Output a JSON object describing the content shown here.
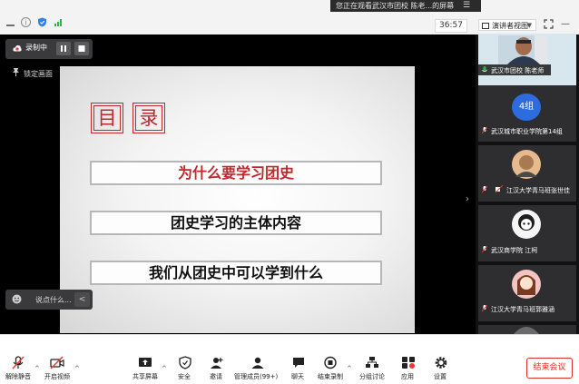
{
  "top_bar": {
    "sharing_banner": "您正在观看武汉市团校 陈老...的屏幕",
    "timer": "36:57",
    "view_mode": "演讲者视图"
  },
  "recording": {
    "label": "录制中"
  },
  "lock_screen": "锁定画面",
  "slide": {
    "toc_chars": [
      "目",
      "录"
    ],
    "items": [
      "为什么要学习团史",
      "团史学习的主体内容",
      "我们从团史中可以学到什么"
    ],
    "highlight_color": "#c0282d"
  },
  "chat": {
    "placeholder": "说点什么..."
  },
  "participants": [
    {
      "name": "武汉市团校 陈老师"
    },
    {
      "name": "武汉城市职业学院第14组",
      "avatar_text": "4组"
    },
    {
      "name": "江汉大学青马班张世佳"
    },
    {
      "name": "武汉商学院 江柯"
    },
    {
      "name": "江汉大学青马班郭雅涵"
    },
    {
      "name": ""
    }
  ],
  "toolbar": {
    "unmute": "解除静音",
    "start_video": "开启视频",
    "share_screen": "共享屏幕",
    "security": "安全",
    "invite": "邀请",
    "manage_members": "管理成员(99+)",
    "chat": "聊天",
    "end_recording": "结束录制",
    "breakout": "分组讨论",
    "apps": "应用",
    "settings": "设置",
    "end_meeting": "结束会议"
  }
}
